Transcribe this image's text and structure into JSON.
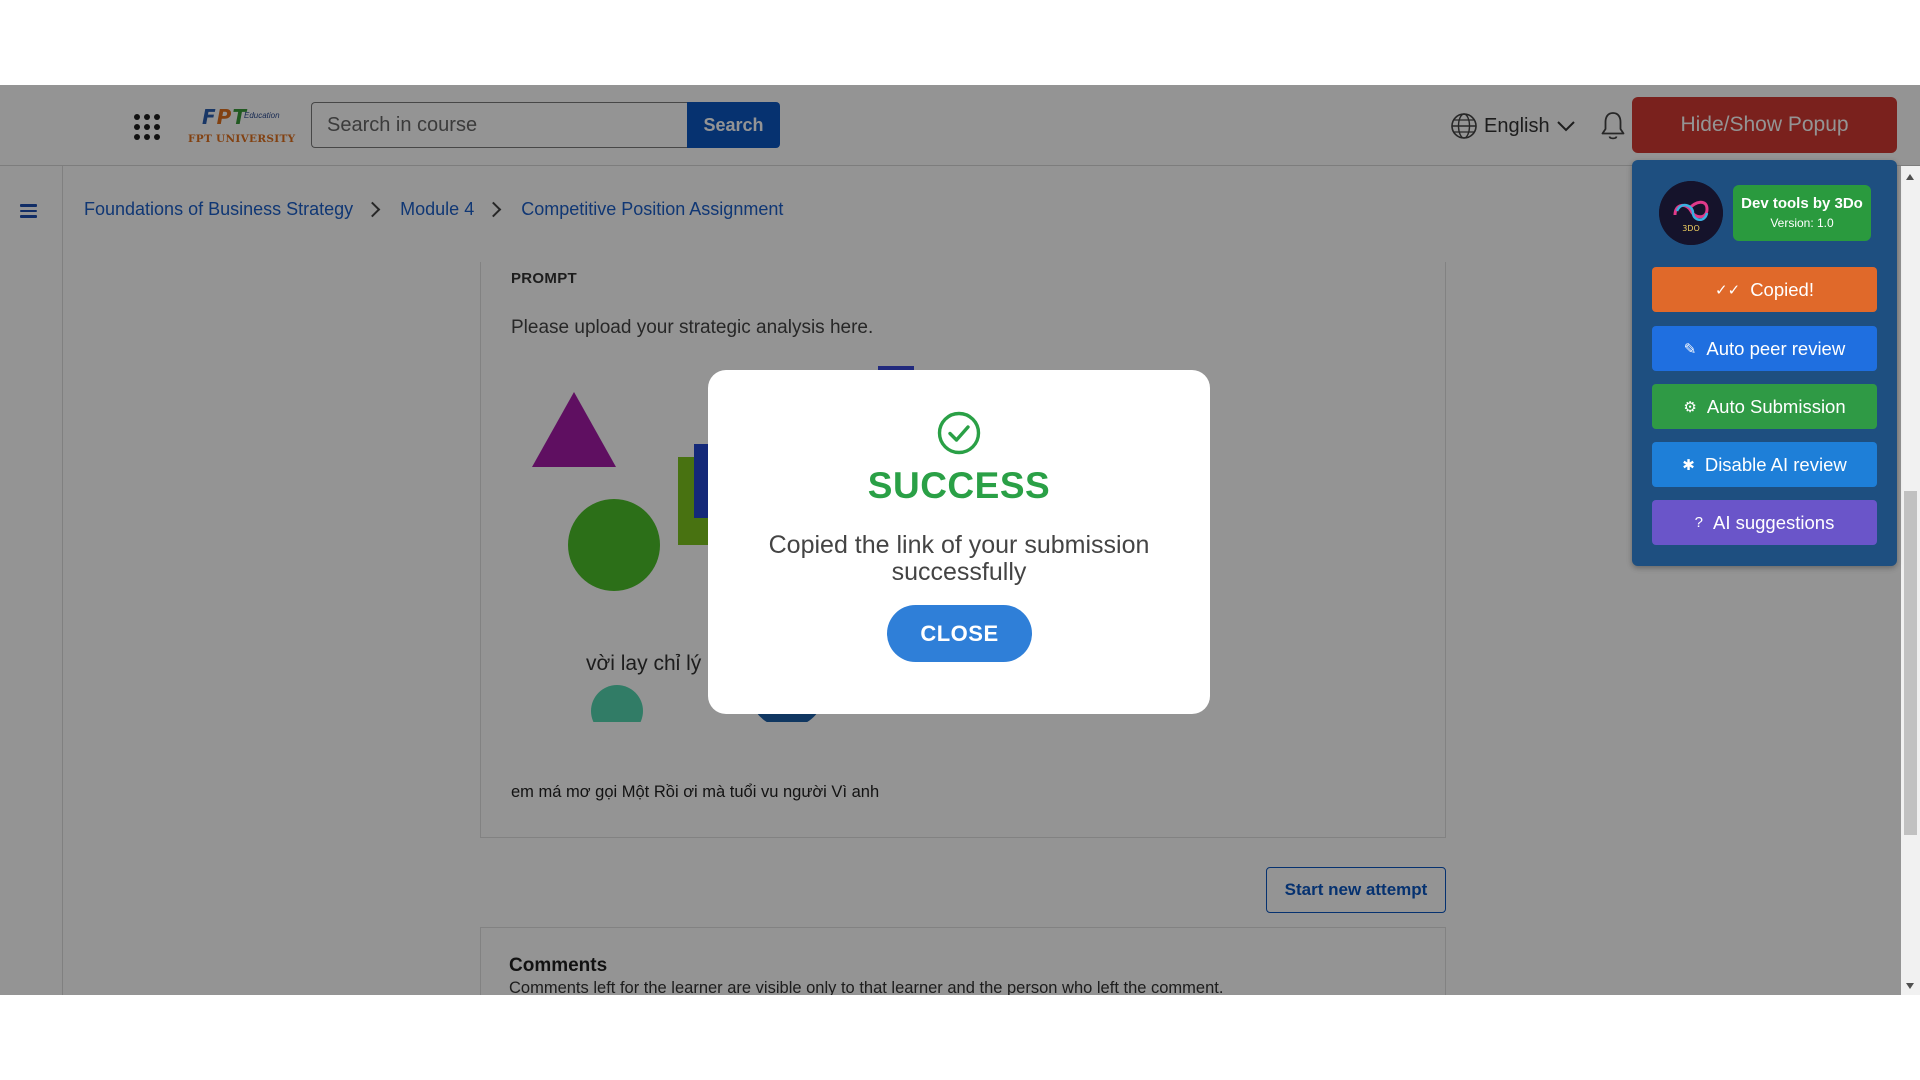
{
  "header": {
    "logo": {
      "mark": "FPT",
      "edu": "Education",
      "uni": "FPT UNIVERSITY"
    },
    "search": {
      "placeholder": "Search in course",
      "button_label": "Search"
    },
    "language": "English",
    "hide_show_label": "Hide/Show Popup"
  },
  "breadcrumb": [
    "Foundations of Business Strategy",
    "Module 4",
    "Competitive Position Assignment"
  ],
  "submission": {
    "prompt_label": "PROMPT",
    "prompt_text": "Please upload your strategic analysis here.",
    "figure_caption": "vời lay chỉ lý",
    "answer_text": "em má mơ gọi Một Rồi ơi mà tuổi vu người Vì anh"
  },
  "start_new_attempt_label": "Start new attempt",
  "comments": {
    "title": "Comments",
    "description": "Comments left for the learner are visible only to that learner and the person who left the comment."
  },
  "devtools": {
    "title": "Dev tools by 3Do",
    "version": "Version: 1.0",
    "avatar_text": "3DO",
    "buttons": [
      {
        "label": "Copied!",
        "icon": "double-check-icon",
        "color": "#e0692a"
      },
      {
        "label": "Auto peer review",
        "icon": "pencil-icon",
        "color": "#1f6fe0"
      },
      {
        "label": "Auto Submission",
        "icon": "gear-icon",
        "color": "#2f9a45"
      },
      {
        "label": "Disable AI review",
        "icon": "bug-icon",
        "color": "#1e7fd8"
      },
      {
        "label": "AI suggestions",
        "icon": "question-icon",
        "color": "#6a55c9"
      }
    ]
  },
  "modal": {
    "title": "SUCCESS",
    "message": "Copied the link of your submission successfully",
    "close_label": "CLOSE"
  },
  "colors": {
    "brand_blue": "#0b56c2",
    "success_green": "#2aa046",
    "popup_red": "#d33a32",
    "devtools_panel": "#1e4f80"
  }
}
